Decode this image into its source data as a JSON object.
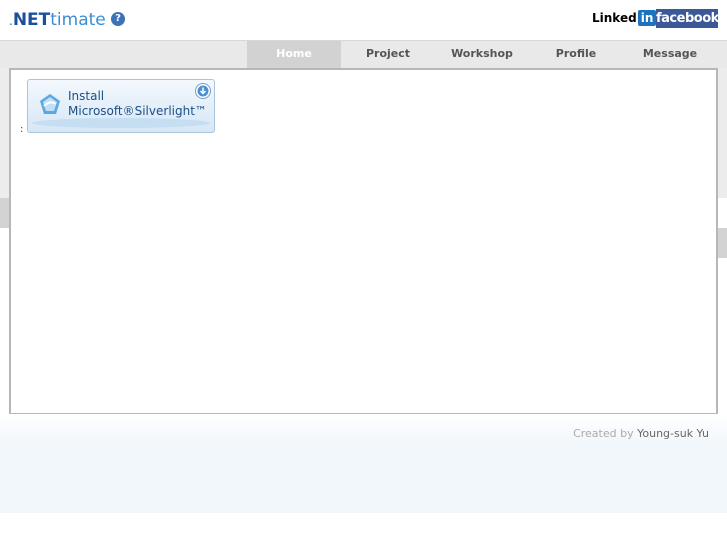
{
  "header": {
    "logo": {
      "dot": ".",
      "net": "NET",
      "rest": "timate"
    },
    "help_icon": "?",
    "linkedin": {
      "text": "Linked",
      "badge": "in"
    },
    "separator": ".",
    "facebook": "facebook"
  },
  "nav": {
    "items": [
      "Home",
      "Project",
      "Workshop",
      "Profile",
      "Message"
    ],
    "active": "Home"
  },
  "content": {
    "colon": ":",
    "silverlight": {
      "line1": "Install",
      "line2": "Microsoft®Silverlight™"
    }
  },
  "footer": {
    "label": "Created by",
    "name": "Young-suk Yu"
  },
  "colors": {
    "accent": "#3a8dd3",
    "facebook": "#3b5998",
    "linkedin": "#1e73be"
  }
}
